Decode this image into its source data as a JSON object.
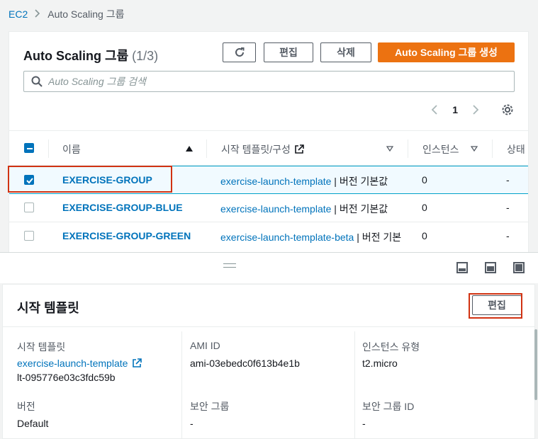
{
  "breadcrumb": {
    "root": "EC2",
    "current": "Auto Scaling 그룹"
  },
  "groups_panel": {
    "title": "Auto Scaling 그룹",
    "count": "(1/3)",
    "edit_label": "편집",
    "delete_label": "삭제",
    "create_label": "Auto Scaling 그룹 생성",
    "search_placeholder": "Auto Scaling 그룹 검색",
    "page_number": "1"
  },
  "table": {
    "columns": [
      "이름",
      "시작 템플릿/구성",
      "인스턴스",
      "상태"
    ],
    "rows": [
      {
        "name": "EXERCISE-GROUP",
        "template": "exercise-launch-template",
        "version": " | 버전 기본값",
        "instances": "0",
        "status": "-",
        "selected": true
      },
      {
        "name": "EXERCISE-GROUP-BLUE",
        "template": "exercise-launch-template",
        "version": " | 버전 기본값",
        "instances": "0",
        "status": "-",
        "selected": false
      },
      {
        "name": "EXERCISE-GROUP-GREEN",
        "template": "exercise-launch-template-beta",
        "version": " | 버전 기본",
        "instances": "0",
        "status": "-",
        "selected": false
      }
    ]
  },
  "detail": {
    "title": "시작 템플릿",
    "edit_label": "편집",
    "launch_template_label": "시작 템플릿",
    "launch_template_name": "exercise-launch-template",
    "launch_template_id": "lt-095776e03c3fdc59b",
    "ami_label": "AMI ID",
    "ami_value": "ami-03ebedc0f613b4e1b",
    "instance_type_label": "인스턴스 유형",
    "instance_type_value": "t2.micro",
    "version_label": "버전",
    "version_value": "Default",
    "security_group_label": "보안 그룹",
    "security_group_value": "-",
    "security_group_id_label": "보안 그룹 ID",
    "security_group_id_value": "-"
  },
  "colors": {
    "link": "#0073bb",
    "primary": "#ec7211",
    "highlight": "#d13212"
  }
}
